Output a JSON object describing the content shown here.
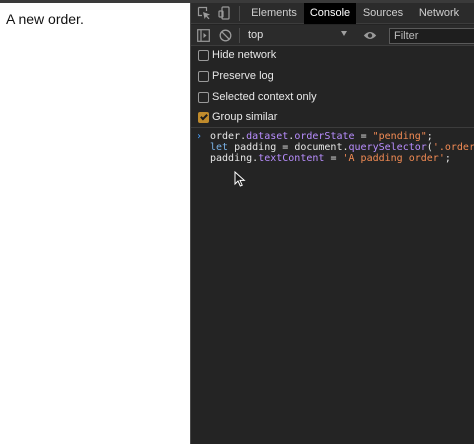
{
  "page": {
    "text": "A new order."
  },
  "devtools": {
    "tabs": [
      {
        "label": "Elements",
        "active": false
      },
      {
        "label": "Console",
        "active": true
      },
      {
        "label": "Sources",
        "active": false
      },
      {
        "label": "Network",
        "active": false
      }
    ],
    "toolbar": {
      "context": "top",
      "filter_placeholder": "Filter"
    },
    "options": [
      {
        "label": "Hide network",
        "checked": false
      },
      {
        "label": "Preserve log",
        "checked": false
      },
      {
        "label": "Selected context only",
        "checked": false
      },
      {
        "label": "Group similar",
        "checked": true
      }
    ],
    "console": {
      "prompt": "›",
      "lines": {
        "l1": {
          "obj": "order",
          "d1": ".",
          "p1": "dataset",
          "d2": ".",
          "p2": "orderState",
          "eq": " = ",
          "s": "\"pending\"",
          "end": ";"
        },
        "l2": {
          "kw": "let ",
          "v": "padding",
          "eq": " = ",
          "obj": "document",
          "d": ".",
          "m": "querySelector",
          "o": "(",
          "s": "'.order'",
          "c": ");"
        },
        "l3": {
          "obj": "padding",
          "d": ".",
          "p": "textContent",
          "eq": " = ",
          "s": "'A padding order'",
          "end": ";"
        }
      }
    }
  },
  "colors": {
    "accent_checkbox": "#c08b2c",
    "prompt": "#4da3ff",
    "string": "#f28b54",
    "property": "#b98eff",
    "keyword": "#7ab3e8"
  }
}
